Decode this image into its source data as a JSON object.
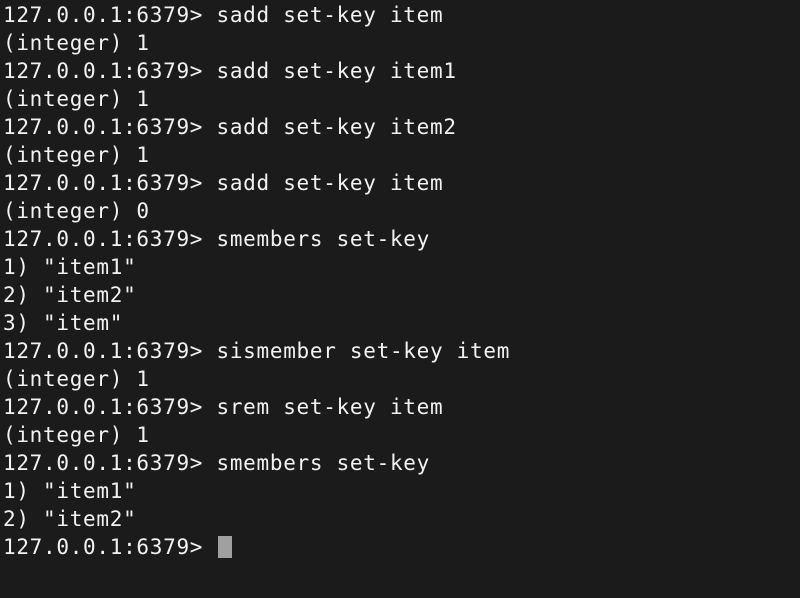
{
  "terminal": {
    "background_color": "#1b1b1b",
    "text_color": "#f2f2f2",
    "cursor_color": "#a0a0a0",
    "prompt": "127.0.0.1:6379>",
    "lines": [
      {
        "type": "command",
        "text": "127.0.0.1:6379> sadd set-key item"
      },
      {
        "type": "output",
        "text": "(integer) 1"
      },
      {
        "type": "command",
        "text": "127.0.0.1:6379> sadd set-key item1"
      },
      {
        "type": "output",
        "text": "(integer) 1"
      },
      {
        "type": "command",
        "text": "127.0.0.1:6379> sadd set-key item2"
      },
      {
        "type": "output",
        "text": "(integer) 1"
      },
      {
        "type": "command",
        "text": "127.0.0.1:6379> sadd set-key item"
      },
      {
        "type": "output",
        "text": "(integer) 0"
      },
      {
        "type": "command",
        "text": "127.0.0.1:6379> smembers set-key"
      },
      {
        "type": "output",
        "text": "1) \"item1\""
      },
      {
        "type": "output",
        "text": "2) \"item2\""
      },
      {
        "type": "output",
        "text": "3) \"item\""
      },
      {
        "type": "command",
        "text": "127.0.0.1:6379> sismember set-key item"
      },
      {
        "type": "output",
        "text": "(integer) 1"
      },
      {
        "type": "command",
        "text": "127.0.0.1:6379> srem set-key item"
      },
      {
        "type": "output",
        "text": "(integer) 1"
      },
      {
        "type": "command",
        "text": "127.0.0.1:6379> smembers set-key"
      },
      {
        "type": "output",
        "text": "1) \"item1\""
      },
      {
        "type": "output",
        "text": "2) \"item2\""
      },
      {
        "type": "prompt",
        "text": "127.0.0.1:6379> "
      }
    ]
  }
}
